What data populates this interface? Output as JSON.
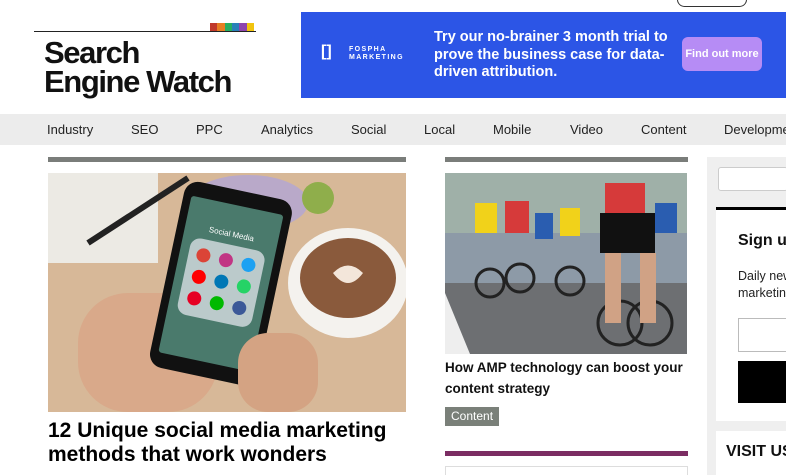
{
  "site": {
    "logo_line1": "Search",
    "logo_line2": "Engine Watch",
    "logo_stripe_colors": [
      "#c0392b",
      "#e67e22",
      "#27ae60",
      "#2980b9",
      "#8e44ad",
      "#f1c40f"
    ]
  },
  "ad": {
    "brand_icon": "[]",
    "brand_line1": "FOSPHA",
    "brand_line2": "MARKETING",
    "headline": "Try our no-brainer 3 month trial to prove the business case for data-driven attribution.",
    "cta": "Find out more",
    "bg_color": "#2c55e6",
    "cta_color": "#b68cf5"
  },
  "nav": {
    "items": [
      "Industry",
      "SEO",
      "PPC",
      "Analytics",
      "Social",
      "Local",
      "Mobile",
      "Video",
      "Content",
      "Development"
    ]
  },
  "main": {
    "lead_title": "12 Unique social media marketing methods that work wonders",
    "lead_image_icon": "phone-social-media-photo",
    "phone_label": "Social Media",
    "second_title": "How AMP technology can boost your content strategy",
    "second_tag": "Content",
    "second_image_icon": "cyclists-race-photo"
  },
  "sidebar": {
    "signup_heading": "Sign up",
    "signup_text_line1": "Daily new",
    "signup_text_line2": "marketing",
    "visit_heading": "VISIT US"
  }
}
